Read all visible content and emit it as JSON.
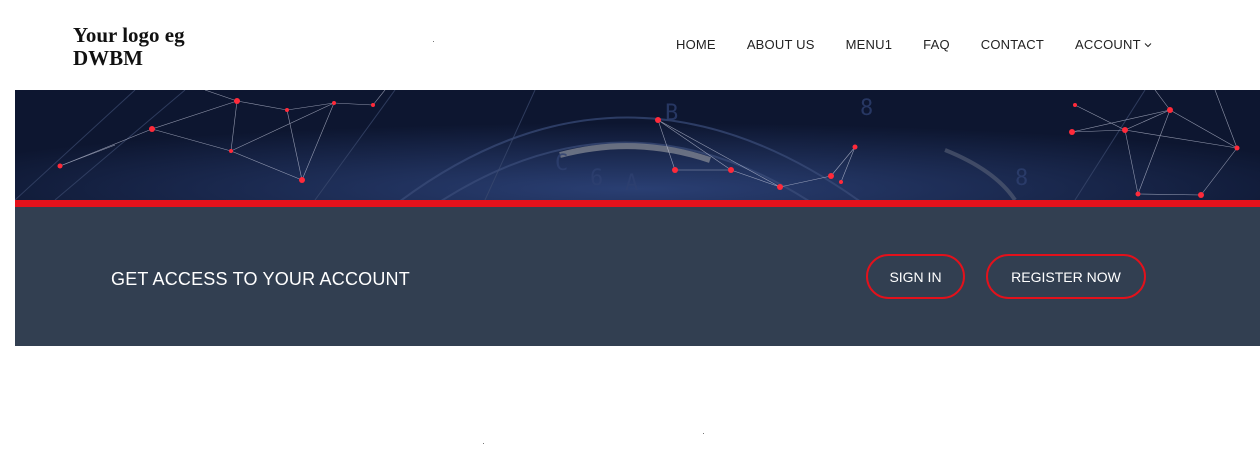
{
  "header": {
    "logo_text": "Your logo eg DWBM",
    "nav": {
      "home": "HOME",
      "about": "ABOUT US",
      "menu1": "MENU1",
      "faq": "FAQ",
      "contact": "CONTACT",
      "account": "ACCOUNT"
    }
  },
  "account_strip": {
    "title": "GET ACCESS TO YOUR ACCOUNT",
    "signin_label": "SIGN IN",
    "register_label": "REGISTER NOW"
  },
  "colors": {
    "accent_red": "#e3111b",
    "strip_bg": "#323f51",
    "hero_bg": "#101a33"
  },
  "icons": {
    "account_dropdown": "chevron-down-icon"
  }
}
